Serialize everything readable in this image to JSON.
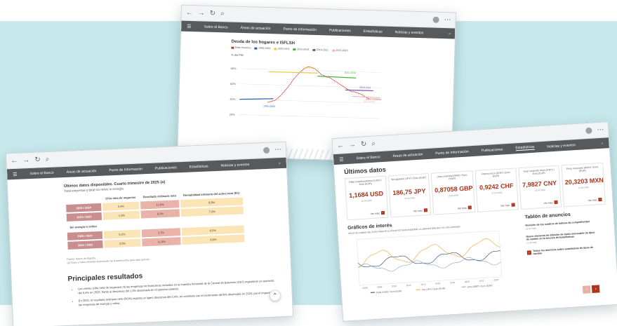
{
  "nav": {
    "items": [
      "Sobre el Banco",
      "Áreas de actuación",
      "Punto de Información",
      "Publicaciones",
      "Estadísticas",
      "Noticias y eventos"
    ]
  },
  "chart_window": {
    "title": "Deuda de los hogares e ISFLSH",
    "legend": [
      {
        "label": "Ratio histórico",
        "color": "#c0392b"
      },
      {
        "label": "1995-2003",
        "color": "#2e5fb2"
      },
      {
        "label": "2003-2011",
        "color": "#f3c240"
      },
      {
        "label": "2011-2019",
        "color": "#48b23e"
      },
      {
        "label": "2019-2021",
        "color": "#7a4aa0"
      },
      {
        "label": "2021-2023",
        "color": "#f0b6b6"
      }
    ],
    "ylabel": "% del PIB",
    "annotations": [
      "1995-2003",
      "2003-2011",
      "2011-2019",
      "2019-2021",
      "2021-2023",
      "Ciclo histórico"
    ],
    "y_ticks": [
      "80%",
      "60%",
      "40%",
      "20%"
    ]
  },
  "chart_data": {
    "type": "line",
    "title": "Deuda de los hogares e ISFLSH",
    "ylabel": "% del PIB",
    "ylim": [
      15,
      90
    ],
    "series": [
      {
        "name": "Ratio histórico",
        "x": [
          0,
          1,
          2,
          3,
          4,
          5,
          6,
          7,
          8,
          9,
          10,
          11,
          12,
          13,
          14,
          15,
          16,
          17,
          18,
          19,
          20,
          21,
          22,
          23,
          24,
          25,
          26,
          27,
          28,
          29,
          30,
          31,
          32,
          33,
          34,
          35,
          36,
          37,
          38,
          39,
          40
        ],
        "values": [
          37,
          38,
          39,
          40,
          43,
          46,
          50,
          54,
          58,
          63,
          68,
          72,
          76,
          79,
          82,
          84,
          85,
          84,
          83,
          81,
          78,
          75,
          74,
          72,
          72,
          70,
          68,
          66,
          64,
          62,
          60,
          58,
          56,
          54,
          54,
          53,
          52,
          51,
          49,
          47,
          45
        ]
      },
      {
        "name": "1995-2003",
        "values": [
          40,
          42
        ]
      },
      {
        "name": "2003-2011",
        "values": [
          77,
          77
        ]
      },
      {
        "name": "2011-2019",
        "values": [
          73,
          72
        ]
      },
      {
        "name": "2019-2021",
        "values": [
          56,
          56
        ]
      },
      {
        "name": "2021-2023",
        "values": [
          48,
          47
        ]
      }
    ]
  },
  "results_window": {
    "subtitle": "Últimos datos disponibles. Cuarto trimestre de 2025 (a)",
    "subtitle2": "Total empresas y total sin refino ni energía",
    "headers": [
      "Cifra neta de negocios",
      "Resultado ordinario neto",
      "Rentabilidad ordinaria del activo neto (R1)"
    ],
    "rows_total": [
      {
        "label": "2025 / 2024",
        "c1": "3,4%",
        "c2": "11,6%",
        "c3": "6,9%"
      },
      {
        "label": "2024 / 2023",
        "c1": "-1,3%",
        "c2": "6,0%",
        "c3": "7,3%"
      }
    ],
    "section2": "Sin energía ni refino",
    "rows_sin": [
      {
        "label": "2025 / 2024",
        "c1": "5,2%",
        "c2": "2,7%",
        "c3": "6,5%"
      },
      {
        "label": "2024 / 2023",
        "c1": "2,0%",
        "c2": "11,6%",
        "c3": "6,6%"
      }
    ],
    "source": "Fuente: Banco de España.",
    "note": "(a) Tasas y ratios referidas al promedio de la submuestra para cada periodo.",
    "heading": "Principales resultados",
    "bullets": [
      "Las ventas (cifra neta de negocios) de las empresas no financieras incluidas en la muestra trimestral de la Central de Balances (CBT) registraron un aumento del 3,4% en 2025, frente al descenso del 1,3% observado en el ejercicio anterior.",
      "En 2025, el resultado ordinario neto (RON) registró un ligero descenso del 0,4%, en contraste con el incremento del 6% observado en 2024, por el impacto de las empresas de energía y refino."
    ]
  },
  "data_window": {
    "title": "Últimos datos",
    "cards": [
      {
        "label": "Dólar estadounidense (USD) / Euro (EUR)",
        "value": "1,1684 USD",
        "date": "12.04.2026",
        "more": "Ver más"
      },
      {
        "label": "Yen japonés (JPY) / Euro (EUR)",
        "value": "186,75 JPY",
        "date": "12.04.2026",
        "more": "Ver más"
      },
      {
        "label": "Libra esterlina (GBP) / Euro (EUR)",
        "value": "0,87058 GBP",
        "date": "12.04.2026",
        "more": "Ver más"
      },
      {
        "label": "Franco suizo (CHF) / Euro (EUR)",
        "value": "0,9242 CHF",
        "date": "12.04.2026",
        "more": "Ver más"
      },
      {
        "label": "Yuan renminbi chino (CNY) / Euro (EUR)",
        "value": "7,9827 CNY",
        "date": "12.04.2026",
        "more": "Ver más"
      },
      {
        "label": "Peso mexicano (MXN) / Euro (EUR)",
        "value": "20,3203 MXN",
        "date": "12.04.2026",
        "more": "Ver más"
      }
    ],
    "graphs_title": "Gráficos de interés",
    "graph_caption": "TIPOS DE CAMBIO DEL EURO FRENTE AL DÓLAR ESTADOUNIDENSE, LA LIBRA ESTERLINA Y EL YEN JAPONÉS",
    "graph_legend": [
      "Dólar (USD) / Euro (EUR)",
      "Yen (JPY) / Euro (EUR)",
      "Libra (GBP) / Euro (EUR)"
    ],
    "graph_years": [
      "2006",
      "2008",
      "2010",
      "2012",
      "2014",
      "2016",
      "2018",
      "2020",
      "2022",
      "2024"
    ],
    "board_title": "Tablón de anuncios",
    "board_items": [
      {
        "text": "Revisión de los cuadros de índices de competitividad",
        "date": "13.04.2026"
      },
      {
        "text": "Nuevo elemento de difusión de datos mensuales de tipos de cambio en la sección de Estadísticas",
        "date": "11.03.2026"
      }
    ],
    "board_all": "Todos los anuncios sobre estadísticas de tipos de cambio",
    "active_nav": "Estadísticas"
  },
  "icons": {
    "scroll_top": "chevron-up-icon",
    "search": "search-icon",
    "menu": "hamburger-icon"
  },
  "colors": {
    "brand": "#b3341d",
    "band": "#c7e9ec",
    "navbar": "#565a5d"
  }
}
